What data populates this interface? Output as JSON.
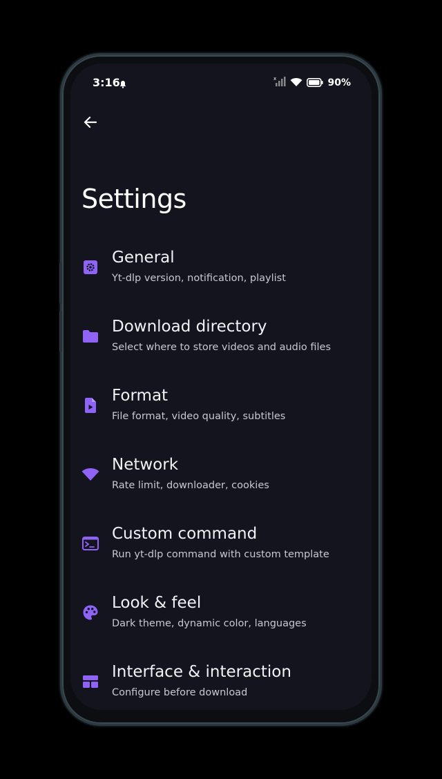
{
  "status_bar": {
    "time": "3:16",
    "battery": "90%"
  },
  "header": {
    "back_icon": "arrow-back-icon",
    "title": "Settings"
  },
  "accent_color": "#8e63f5",
  "settings": [
    {
      "icon": "gear-icon",
      "title": "General",
      "subtitle": "Yt-dlp version, notification, playlist"
    },
    {
      "icon": "folder-icon",
      "title": "Download directory",
      "subtitle": "Select where to store videos and audio files"
    },
    {
      "icon": "file-video-icon",
      "title": "Format",
      "subtitle": "File format, video quality, subtitles"
    },
    {
      "icon": "wifi-icon",
      "title": "Network",
      "subtitle": "Rate limit, downloader, cookies"
    },
    {
      "icon": "terminal-icon",
      "title": "Custom command",
      "subtitle": "Run yt-dlp command with custom template"
    },
    {
      "icon": "palette-icon",
      "title": "Look & feel",
      "subtitle": "Dark theme, dynamic color, languages"
    },
    {
      "icon": "dashboard-icon",
      "title": "Interface & interaction",
      "subtitle": "Configure before download"
    }
  ]
}
